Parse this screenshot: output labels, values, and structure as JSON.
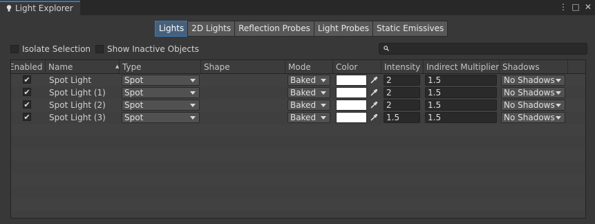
{
  "window": {
    "tab_title": "Light Explorer",
    "controls": [
      "⋮",
      "□",
      "✕"
    ]
  },
  "toolbar": {
    "tabs": [
      {
        "label": "Lights",
        "active": true
      },
      {
        "label": "2D Lights",
        "active": false
      },
      {
        "label": "Reflection Probes",
        "active": false
      },
      {
        "label": "Light Probes",
        "active": false
      },
      {
        "label": "Static Emissives",
        "active": false
      }
    ]
  },
  "options": {
    "isolate_selection": "Isolate Selection",
    "show_inactive": "Show Inactive Objects",
    "search_value": ""
  },
  "table": {
    "columns": [
      "Enabled",
      "Name",
      "Type",
      "Shape",
      "Mode",
      "Color",
      "Intensity",
      "Indirect Multiplier",
      "Shadows"
    ],
    "rows": [
      {
        "enabled": true,
        "name": "Spot Light",
        "type": "Spot",
        "mode": "Baked",
        "color": "#ffffff",
        "intensity": "2",
        "indirect": "1.5",
        "shadows": "No Shadows"
      },
      {
        "enabled": true,
        "name": "Spot Light (1)",
        "type": "Spot",
        "mode": "Baked",
        "color": "#ffffff",
        "intensity": "2",
        "indirect": "1.5",
        "shadows": "No Shadows"
      },
      {
        "enabled": true,
        "name": "Spot Light (2)",
        "type": "Spot",
        "mode": "Baked",
        "color": "#ffffff",
        "intensity": "2",
        "indirect": "1.5",
        "shadows": "No Shadows"
      },
      {
        "enabled": true,
        "name": "Spot Light (3)",
        "type": "Spot",
        "mode": "Baked",
        "color": "#ffffff",
        "intensity": "1.5",
        "indirect": "1.5",
        "shadows": "No Shadows"
      }
    ]
  }
}
